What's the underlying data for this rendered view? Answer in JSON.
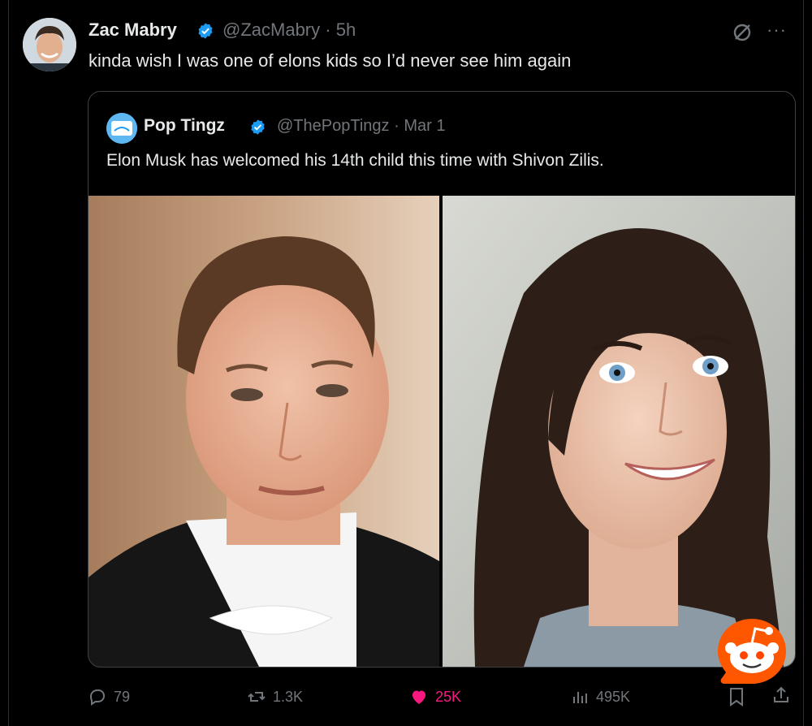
{
  "tweet": {
    "author_name": "Zac Mabry",
    "author_handle": "@ZacMabry",
    "time": "5h",
    "text": "kinda wish I was one of elons kids so I’d never see him again"
  },
  "quoted_tweet": {
    "author_name": "Pop Tingz",
    "author_handle": "@ThePopTingz",
    "date": "Mar 1",
    "text": "Elon Musk has welcomed his 14th child this time with Shivon Zilis.",
    "avatar_text": "Pop Tingz"
  },
  "actions": {
    "replies": "79",
    "reposts": "1.3K",
    "likes": "25K",
    "views": "495K"
  },
  "separator": "·",
  "colors": {
    "background": "#000000",
    "verified": "#1d9bf0",
    "like": "#f91880",
    "muted": "#71767b",
    "reddit_orange": "#ff5700"
  },
  "icons": [
    "verified-icon",
    "grok-icon",
    "more-icon",
    "reply-icon",
    "repost-icon",
    "like-icon",
    "views-icon",
    "bookmark-icon",
    "share-icon",
    "reddit-logo"
  ]
}
